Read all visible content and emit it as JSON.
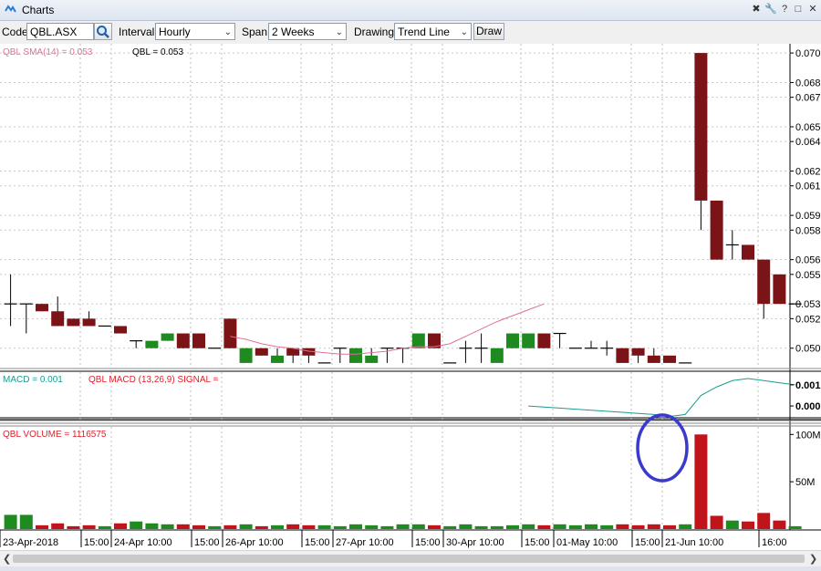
{
  "window": {
    "title": "Charts",
    "controls": [
      "pin-icon",
      "wrench-icon",
      "help-icon",
      "restore-icon",
      "close-icon"
    ]
  },
  "toolbar": {
    "code_label": "Code",
    "code_value": "QBL.ASX",
    "interval_label": "Interval",
    "interval_value": "Hourly",
    "span_label": "Span",
    "span_value": "2 Weeks",
    "drawing_label": "Drawing",
    "drawing_value": "Trend Line",
    "draw_button": "Draw"
  },
  "colors": {
    "up": "#1f8a1f",
    "down": "#7b1416",
    "sma": "#e0709a",
    "macd": "#1a9c8e",
    "volume_label": "#e0202a",
    "annotation": "#3a3acc"
  },
  "chart_data": [
    {
      "type": "candlestick",
      "legend": [
        "QBL SMA(14) = 0.053",
        "QBL = 0.053"
      ],
      "y_ticks": [
        "0.070",
        "0.068",
        "0.067",
        "0.065",
        "0.064",
        "0.062",
        "0.061",
        "0.059",
        "0.058",
        "0.056",
        "0.055",
        "0.053",
        "0.052",
        "0.050"
      ],
      "ylim": [
        0.0485,
        0.0705
      ],
      "candles": [
        {
          "o": 0.053,
          "h": 0.055,
          "l": 0.0515,
          "c": 0.053
        },
        {
          "o": 0.053,
          "h": 0.053,
          "l": 0.051,
          "c": 0.053
        },
        {
          "o": 0.053,
          "h": 0.053,
          "l": 0.0525,
          "c": 0.0525
        },
        {
          "o": 0.0525,
          "h": 0.0535,
          "l": 0.0515,
          "c": 0.0515
        },
        {
          "o": 0.052,
          "h": 0.052,
          "l": 0.0515,
          "c": 0.0515
        },
        {
          "o": 0.052,
          "h": 0.0525,
          "l": 0.0515,
          "c": 0.0515
        },
        {
          "o": 0.0515,
          "h": 0.0515,
          "l": 0.0515,
          "c": 0.0515
        },
        {
          "o": 0.0515,
          "h": 0.0515,
          "l": 0.051,
          "c": 0.051
        },
        {
          "o": 0.0505,
          "h": 0.0505,
          "l": 0.05,
          "c": 0.0505
        },
        {
          "o": 0.05,
          "h": 0.05,
          "l": 0.05,
          "c": 0.0505
        },
        {
          "o": 0.0505,
          "h": 0.051,
          "l": 0.0505,
          "c": 0.051
        },
        {
          "o": 0.051,
          "h": 0.051,
          "l": 0.05,
          "c": 0.05
        },
        {
          "o": 0.051,
          "h": 0.051,
          "l": 0.05,
          "c": 0.05
        },
        {
          "o": 0.05,
          "h": 0.05,
          "l": 0.05,
          "c": 0.05
        },
        {
          "o": 0.052,
          "h": 0.052,
          "l": 0.05,
          "c": 0.05
        },
        {
          "o": 0.049,
          "h": 0.05,
          "l": 0.049,
          "c": 0.05
        },
        {
          "o": 0.05,
          "h": 0.05,
          "l": 0.0495,
          "c": 0.0495
        },
        {
          "o": 0.049,
          "h": 0.05,
          "l": 0.049,
          "c": 0.0495
        },
        {
          "o": 0.05,
          "h": 0.05,
          "l": 0.049,
          "c": 0.0495
        },
        {
          "o": 0.05,
          "h": 0.05,
          "l": 0.049,
          "c": 0.0495
        },
        {
          "o": 0.049,
          "h": 0.049,
          "l": 0.049,
          "c": 0.049
        },
        {
          "o": 0.05,
          "h": 0.05,
          "l": 0.049,
          "c": 0.05
        },
        {
          "o": 0.049,
          "h": 0.05,
          "l": 0.049,
          "c": 0.05
        },
        {
          "o": 0.049,
          "h": 0.05,
          "l": 0.049,
          "c": 0.0495
        },
        {
          "o": 0.05,
          "h": 0.05,
          "l": 0.049,
          "c": 0.05
        },
        {
          "o": 0.05,
          "h": 0.05,
          "l": 0.049,
          "c": 0.05
        },
        {
          "o": 0.05,
          "h": 0.051,
          "l": 0.05,
          "c": 0.051
        },
        {
          "o": 0.051,
          "h": 0.051,
          "l": 0.05,
          "c": 0.05
        },
        {
          "o": 0.049,
          "h": 0.049,
          "l": 0.049,
          "c": 0.049
        },
        {
          "o": 0.05,
          "h": 0.0505,
          "l": 0.049,
          "c": 0.05
        },
        {
          "o": 0.05,
          "h": 0.051,
          "l": 0.049,
          "c": 0.05
        },
        {
          "o": 0.049,
          "h": 0.049,
          "l": 0.049,
          "c": 0.05
        },
        {
          "o": 0.05,
          "h": 0.051,
          "l": 0.05,
          "c": 0.051
        },
        {
          "o": 0.05,
          "h": 0.051,
          "l": 0.05,
          "c": 0.051
        },
        {
          "o": 0.051,
          "h": 0.051,
          "l": 0.05,
          "c": 0.05
        },
        {
          "o": 0.051,
          "h": 0.051,
          "l": 0.05,
          "c": 0.051
        },
        {
          "o": 0.05,
          "h": 0.05,
          "l": 0.05,
          "c": 0.05
        },
        {
          "o": 0.05,
          "h": 0.0505,
          "l": 0.05,
          "c": 0.05
        },
        {
          "o": 0.05,
          "h": 0.0505,
          "l": 0.0495,
          "c": 0.05
        },
        {
          "o": 0.05,
          "h": 0.05,
          "l": 0.049,
          "c": 0.049
        },
        {
          "o": 0.05,
          "h": 0.05,
          "l": 0.049,
          "c": 0.0495
        },
        {
          "o": 0.0495,
          "h": 0.05,
          "l": 0.049,
          "c": 0.049
        },
        {
          "o": 0.0495,
          "h": 0.0495,
          "l": 0.049,
          "c": 0.049
        },
        {
          "o": 0.049,
          "h": 0.049,
          "l": 0.049,
          "c": 0.049
        },
        {
          "o": 0.07,
          "h": 0.07,
          "l": 0.058,
          "c": 0.06
        },
        {
          "o": 0.06,
          "h": 0.06,
          "l": 0.056,
          "c": 0.056
        },
        {
          "o": 0.057,
          "h": 0.058,
          "l": 0.056,
          "c": 0.057
        },
        {
          "o": 0.057,
          "h": 0.057,
          "l": 0.056,
          "c": 0.056
        },
        {
          "o": 0.056,
          "h": 0.056,
          "l": 0.052,
          "c": 0.053
        },
        {
          "o": 0.055,
          "h": 0.055,
          "l": 0.053,
          "c": 0.053
        },
        {
          "o": 0.053,
          "h": 0.053,
          "l": 0.053,
          "c": 0.053
        }
      ],
      "sma": [
        0.0508,
        0.0506,
        0.0503,
        0.0501,
        0.05,
        0.0498,
        0.0497,
        0.0496,
        0.0496,
        0.0497,
        0.0498,
        0.05,
        0.0501,
        0.0501,
        0.0503,
        0.0508,
        0.0513,
        0.0518,
        0.0522,
        0.0526,
        0.053
      ],
      "sma_start_index": 14
    },
    {
      "type": "line",
      "legend": [
        "MACD = 0.001",
        "QBL MACD (13,26,9) SIGNAL ="
      ],
      "y_ticks": [
        "0.001",
        "0.000"
      ],
      "ylim": [
        -0.0006,
        0.0016
      ],
      "x_start_index": 33,
      "values": [
        0.0,
        -5e-05,
        -0.0001,
        -0.00015,
        -0.0002,
        -0.00025,
        -0.0003,
        -0.00035,
        -0.0004,
        -0.0005,
        -0.0004,
        0.0005,
        0.0009,
        0.0012,
        0.0013,
        0.0012,
        0.0011,
        0.001
      ]
    },
    {
      "type": "bar",
      "legend": [
        "QBL VOLUME = 1116575"
      ],
      "y_ticks": [
        "100M",
        "50M"
      ],
      "ylim": [
        0,
        108
      ],
      "unit": "M",
      "values": [
        15,
        15,
        4,
        6,
        3,
        4,
        3,
        6,
        8,
        6,
        5,
        5,
        4,
        3,
        4,
        5,
        3,
        4,
        5,
        4,
        4,
        3,
        5,
        4,
        3,
        5,
        5,
        4,
        3,
        5,
        3,
        3,
        4,
        5,
        4,
        5,
        4,
        5,
        4,
        5,
        4,
        5,
        4,
        5,
        100,
        14,
        9,
        8,
        17,
        9,
        3
      ],
      "annotation": "circled-spike"
    }
  ],
  "x_axis_labels": [
    "23-Apr-2018",
    "15:00",
    "24-Apr 10:00",
    "15:00",
    "26-Apr 10:00",
    "15:00",
    "27-Apr 10:00",
    "15:00",
    "30-Apr 10:00",
    "15:00",
    "01-May 10:00",
    "15:00",
    "21-Jun 10:00",
    "16:00"
  ]
}
